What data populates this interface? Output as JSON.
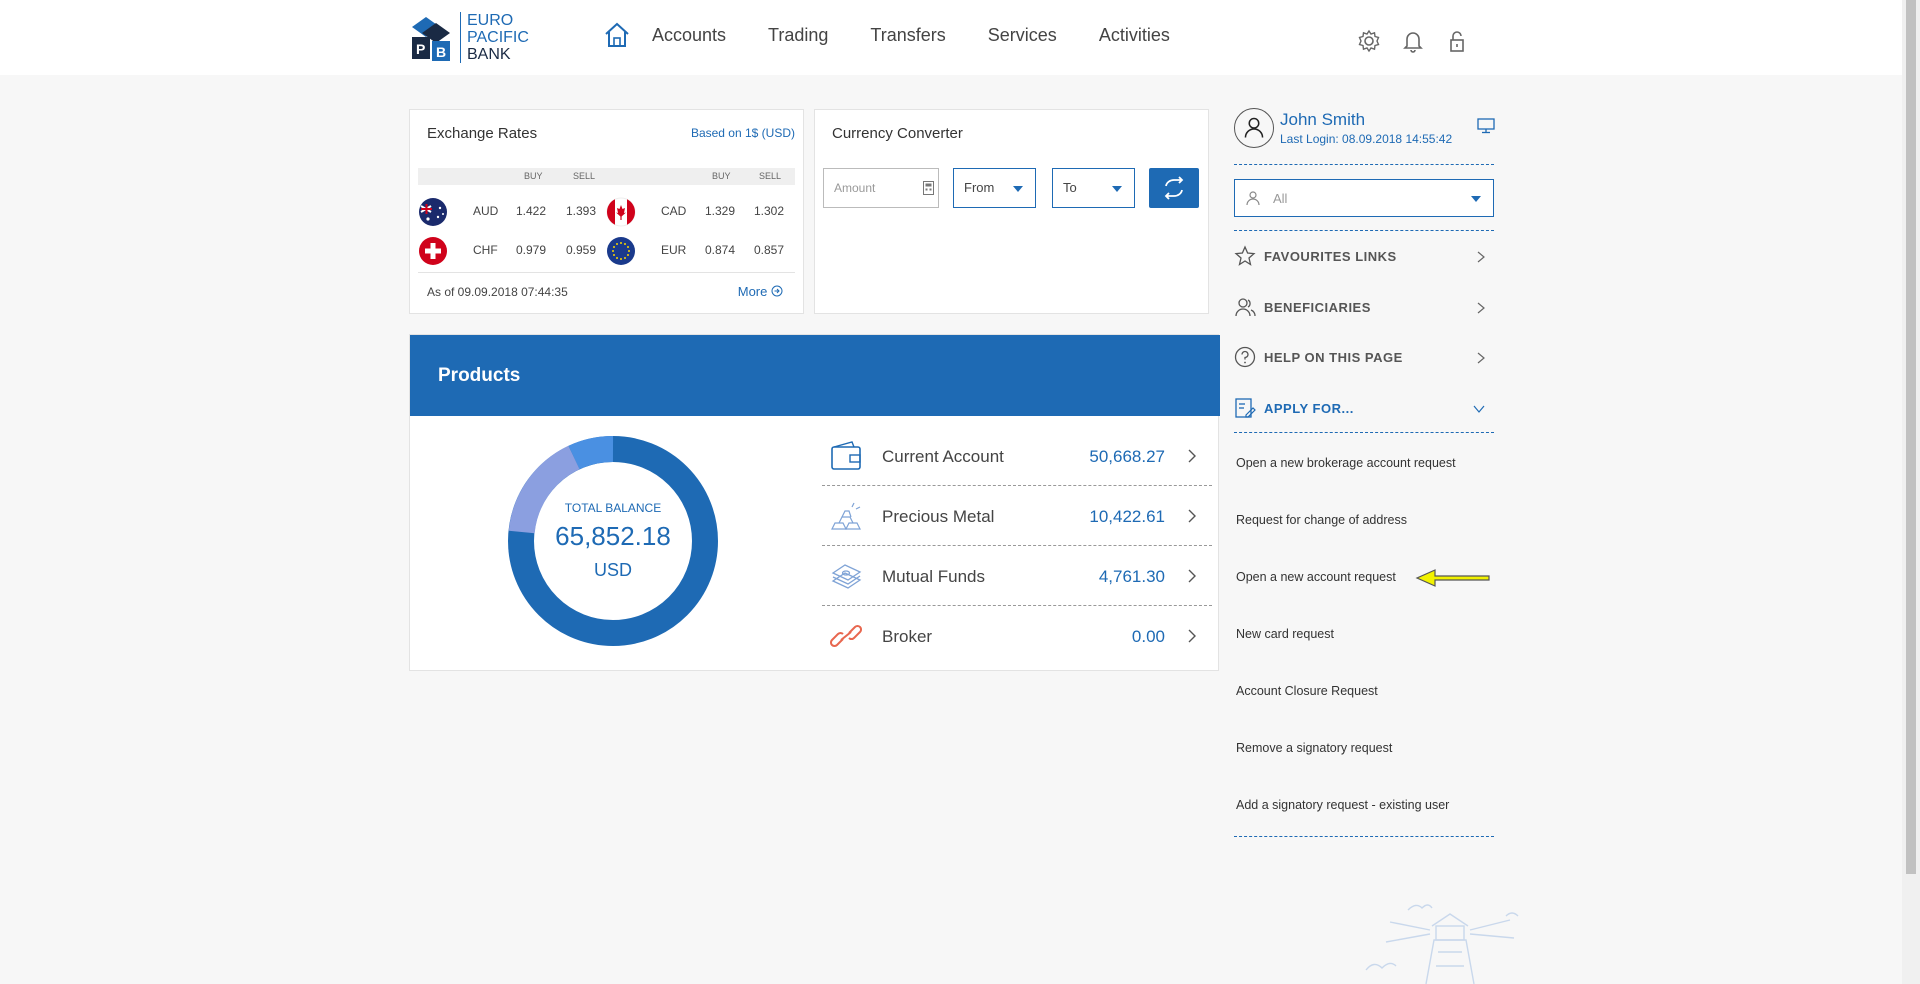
{
  "logo": {
    "line1": "EURO",
    "line2": "PACIFIC",
    "line3": "BANK"
  },
  "nav": {
    "items": [
      "Accounts",
      "Trading",
      "Transfers",
      "Services",
      "Activities"
    ]
  },
  "exchange": {
    "title": "Exchange Rates",
    "based": "Based on 1$ (USD)",
    "head": {
      "buy": "BUY",
      "sell": "SELL"
    },
    "rows": [
      {
        "c1": "AUD",
        "b1": "1.422",
        "s1": "1.393",
        "c2": "CAD",
        "b2": "1.329",
        "s2": "1.302"
      },
      {
        "c1": "CHF",
        "b1": "0.979",
        "s1": "0.959",
        "c2": "EUR",
        "b2": "0.874",
        "s2": "0.857"
      }
    ],
    "asof": "As of 09.09.2018 07:44:35",
    "more": "More"
  },
  "converter": {
    "title": "Currency Converter",
    "amount_placeholder": "Amount",
    "from": "From",
    "to": "To"
  },
  "products": {
    "title": "Products",
    "total_label": "TOTAL BALANCE",
    "total_value": "65,852.18",
    "currency": "USD",
    "items": [
      {
        "name": "Current Account",
        "value": "50,668.27"
      },
      {
        "name": "Precious Metal",
        "value": "10,422.61"
      },
      {
        "name": "Mutual Funds",
        "value": "4,761.30"
      },
      {
        "name": "Broker",
        "value": "0.00"
      }
    ]
  },
  "user": {
    "name": "John Smith",
    "last_login": "Last Login: 08.09.2018 14:55:42"
  },
  "sidebar": {
    "filter": "All",
    "links": [
      {
        "label": "FAVOURITES LINKS"
      },
      {
        "label": "BENEFICIARIES"
      },
      {
        "label": "HELP ON THIS PAGE"
      },
      {
        "label": "APPLY FOR..."
      }
    ],
    "requests": [
      "Open a new brokerage account request",
      "Request for change of address",
      "Open a new account request",
      "New card request",
      "Account Closure Request",
      "Remove a signatory request",
      "Add a signatory request - existing user"
    ]
  },
  "colors": {
    "brand": "#1e6ab4",
    "donut_light": "#8b9fe0",
    "donut_mid": "#4a90e2",
    "annotation": "#f2f200"
  }
}
